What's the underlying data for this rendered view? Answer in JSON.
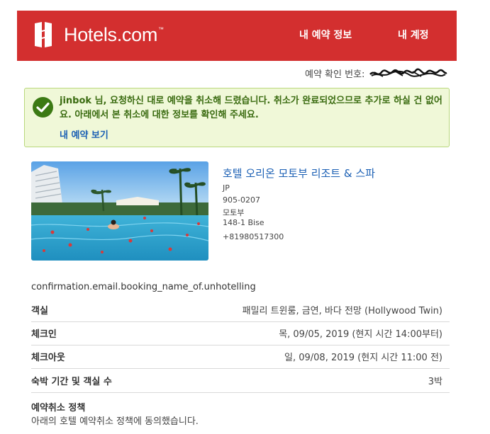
{
  "header": {
    "brand": "Hotels.com",
    "brand_tm": "™",
    "nav_reservations": "내 예약 정보",
    "nav_account": "내 계정"
  },
  "confirmation": {
    "label": "예약 확인 번호:"
  },
  "notice": {
    "message": "jinbok 님, 요청하신 대로 예약을 취소해 드렸습니다. 취소가 완료되었으므로 추가로 하실 건 없어요. 아래에서 본 취소에 대한 정보를 확인해 주세요.",
    "link": "내 예약 보기"
  },
  "hotel": {
    "name": "호텔 오리온 모토부 리조트 & 스파",
    "country": "JP",
    "postal": "905-0207",
    "city": "모토부",
    "street": "148-1 Bise",
    "phone": "+81980517300"
  },
  "booking_name_placeholder": "confirmation.email.booking_name_of.unhotelling",
  "details": [
    {
      "label": "객실",
      "value": "패밀리 트윈룸, 금연, 바다 전망 (Hollywood Twin)"
    },
    {
      "label": "체크인",
      "value": "목, 09/05, 2019 (현지 시간 14:00부터)"
    },
    {
      "label": "체크아웃",
      "value": "일, 09/08, 2019 (현지 시간 11:00 전)"
    },
    {
      "label": "숙박 기간 및 객실 수",
      "value": "3박"
    }
  ],
  "policy": {
    "title": "예약취소 정책",
    "text": "아래의 호텔 예약취소 정책에 동의했습니다."
  },
  "colors": {
    "brand_red": "#d32f2f",
    "notice_bg": "#f0f8d8",
    "notice_text": "#3a6b10",
    "link_blue": "#1a5fb4"
  }
}
